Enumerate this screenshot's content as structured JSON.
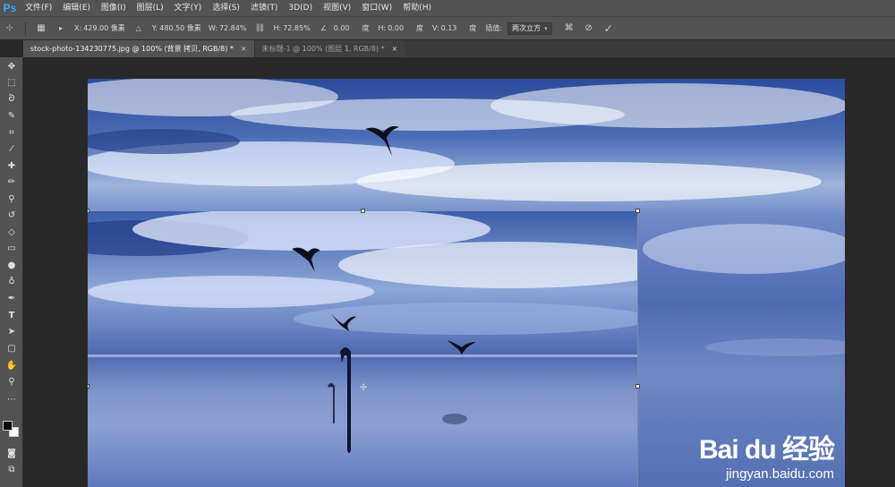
{
  "app": {
    "logo": "Ps"
  },
  "menu": [
    "文件(F)",
    "编辑(E)",
    "图像(I)",
    "图层(L)",
    "文字(Y)",
    "选择(S)",
    "滤镜(T)",
    "3D(D)",
    "视图(V)",
    "窗口(W)",
    "帮助(H)"
  ],
  "options": {
    "x_label": "X:",
    "x_value": "429.00 像素",
    "y_label": "Y:",
    "y_value": "480.50 像素",
    "w_label": "W:",
    "w_value": "72.84%",
    "h_label": "H:",
    "h_value": "72.85%",
    "angle_value": "0.00",
    "angle_unit": "度",
    "hskew_label": "H:",
    "hskew_value": "0.00",
    "hskew_unit": "度",
    "vskew_label": "V:",
    "vskew_value": "0.13",
    "vskew_unit": "度",
    "interp_label": "插值:",
    "interp_value": "两次立方"
  },
  "tabs": [
    {
      "label": "stock-photo-134230775.jpg @ 100% (背景 拷贝, RGB/8) *",
      "close": "×"
    },
    {
      "label": "未标题-1 @ 100% (图层 1, RGB/8) *",
      "close": "×"
    }
  ],
  "watermark": {
    "logo": "Bai du 经验",
    "url": "jingyan.baidu.com"
  },
  "colors": {
    "ui_dark": "#535353",
    "canvas_bg": "#282828",
    "ps_blue": "#31a8ff"
  }
}
